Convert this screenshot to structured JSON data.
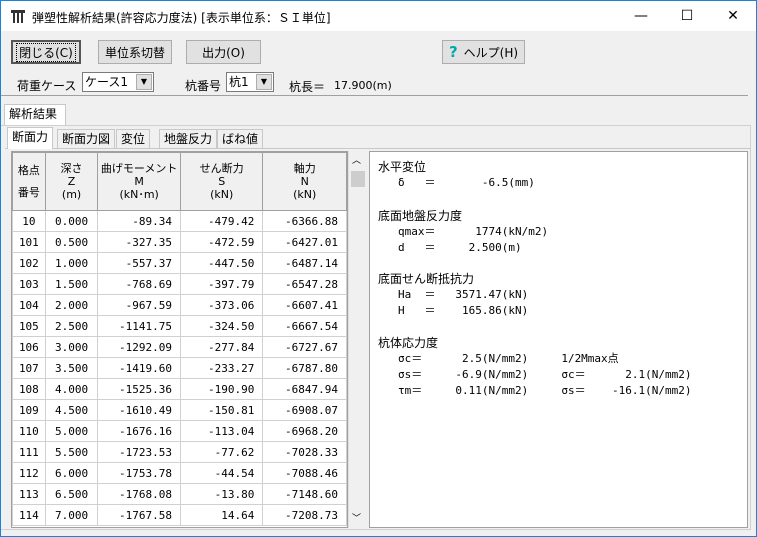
{
  "window": {
    "title": "弾塑性解析結果(許容応力度法) [表示単位系：ＳＩ単位]",
    "minimize": "—",
    "maximize": "☐",
    "close": "✕"
  },
  "toolbar": {
    "close_label": "閉じる(C)",
    "unit_switch_label": "単位系切替",
    "output_label": "出力(O)",
    "help_label": "ヘルプ(H)",
    "help_icon": "?"
  },
  "filters": {
    "load_case_label": "荷重ケース",
    "load_case_value": "ケース1",
    "pile_no_label": "杭番号",
    "pile_no_value": "杭1",
    "pile_length_label": "杭長＝",
    "pile_length_value": "17.900(m)"
  },
  "outer_tab": "解析結果",
  "tabs": [
    "断面力",
    "断面力図",
    "変位",
    "地盤反力",
    "ばね値"
  ],
  "table": {
    "headers": [
      [
        "格点",
        "番号"
      ],
      [
        "深さ",
        "Z",
        "(m)"
      ],
      [
        "曲げモーメント",
        "M",
        "(kN･m)"
      ],
      [
        "せん断力",
        "S",
        "(kN)"
      ],
      [
        "軸力",
        "N",
        "(kN)"
      ]
    ],
    "rows": [
      [
        "10",
        "0.000",
        "-89.34",
        "-479.42",
        "-6366.88"
      ],
      [
        "101",
        "0.500",
        "-327.35",
        "-472.59",
        "-6427.01"
      ],
      [
        "102",
        "1.000",
        "-557.37",
        "-447.50",
        "-6487.14"
      ],
      [
        "103",
        "1.500",
        "-768.69",
        "-397.79",
        "-6547.28"
      ],
      [
        "104",
        "2.000",
        "-967.59",
        "-373.06",
        "-6607.41"
      ],
      [
        "105",
        "2.500",
        "-1141.75",
        "-324.50",
        "-6667.54"
      ],
      [
        "106",
        "3.000",
        "-1292.09",
        "-277.84",
        "-6727.67"
      ],
      [
        "107",
        "3.500",
        "-1419.60",
        "-233.27",
        "-6787.80"
      ],
      [
        "108",
        "4.000",
        "-1525.36",
        "-190.90",
        "-6847.94"
      ],
      [
        "109",
        "4.500",
        "-1610.49",
        "-150.81",
        "-6908.07"
      ],
      [
        "110",
        "5.000",
        "-1676.16",
        "-113.04",
        "-6968.20"
      ],
      [
        "111",
        "5.500",
        "-1723.53",
        "-77.62",
        "-7028.33"
      ],
      [
        "112",
        "6.000",
        "-1753.78",
        "-44.54",
        "-7088.46"
      ],
      [
        "113",
        "6.500",
        "-1768.08",
        "-13.80",
        "-7148.60"
      ],
      [
        "114",
        "7.000",
        "-1767.58",
        "14.64",
        "-7208.73"
      ]
    ]
  },
  "results": {
    "h_disp_title": "水平変位",
    "delta": "δ   ＝       -6.5(mm)",
    "base_title": "底面地盤反力度",
    "qmax": "qmax＝      1774(kN/m2)",
    "d": "d   ＝     2.500(m)",
    "shear_title": "底面せん断抵抗力",
    "Ha": "Ha  ＝   3571.47(kN)",
    "H": "H   ＝    165.86(kN)",
    "stress_title": "杭体応力度",
    "s1": "σc＝      2.5(N/mm2)     1/2Mmax点",
    "s2": "σs＝     -6.9(N/mm2)     σc＝      2.1(N/mm2)",
    "s3": "τm＝     0.11(N/mm2)     σs＝    -16.1(N/mm2)"
  }
}
